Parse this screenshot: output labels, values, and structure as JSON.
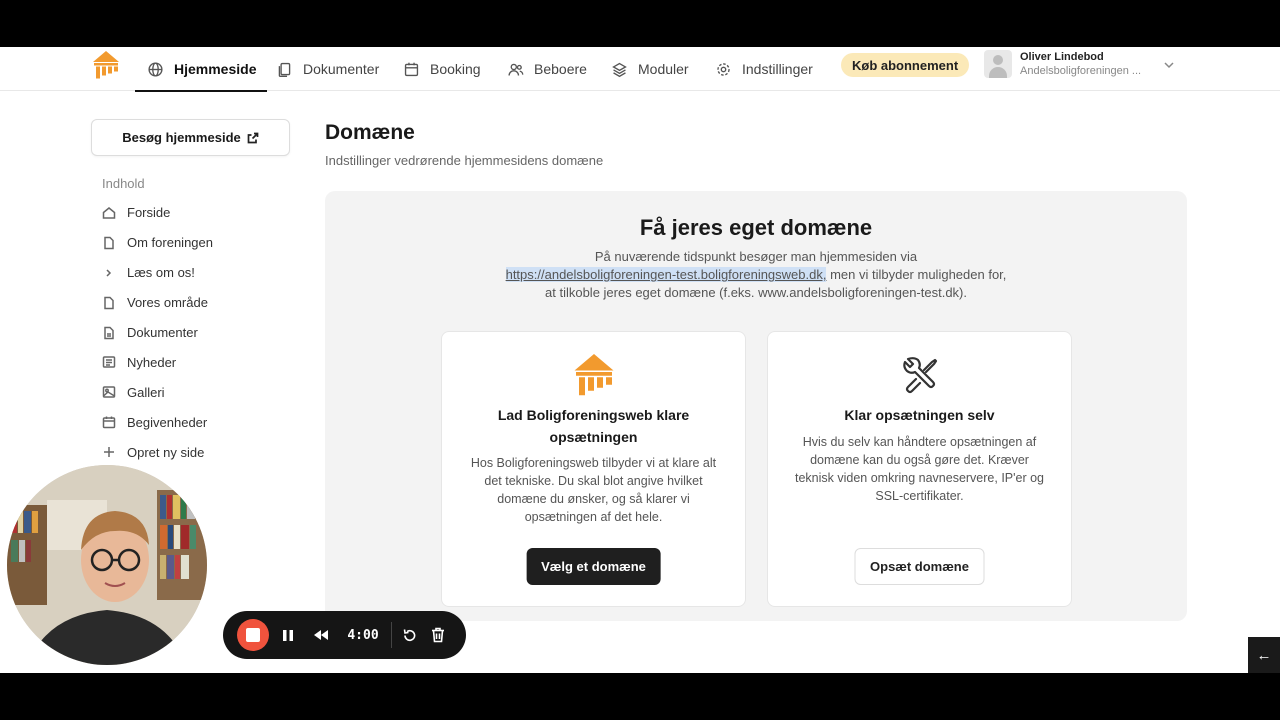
{
  "nav": {
    "items": [
      {
        "label": "Hjemmeside",
        "icon": "globe-icon",
        "active": true
      },
      {
        "label": "Dokumenter",
        "icon": "documents-icon"
      },
      {
        "label": "Booking",
        "icon": "calendar-icon"
      },
      {
        "label": "Beboere",
        "icon": "users-icon"
      },
      {
        "label": "Moduler",
        "icon": "layers-icon"
      },
      {
        "label": "Indstillinger",
        "icon": "gear-icon"
      }
    ],
    "buy_label": "Køb abonnement",
    "user_name": "Oliver Lindebod",
    "user_org": "Andelsboligforeningen ...",
    "accent_color": "#f29a2e",
    "buy_bg_color": "#fbe9b8"
  },
  "sidebar": {
    "visit_label": "Besøg hjemmeside",
    "heading": "Indhold",
    "items": [
      {
        "label": "Forside",
        "icon": "home-icon"
      },
      {
        "label": "Om foreningen",
        "icon": "page-icon"
      },
      {
        "label": "Læs om os!",
        "icon": "chevron-right-icon"
      },
      {
        "label": "Vores område",
        "icon": "page-icon"
      },
      {
        "label": "Dokumenter",
        "icon": "document-icon"
      },
      {
        "label": "Nyheder",
        "icon": "newspaper-icon"
      },
      {
        "label": "Galleri",
        "icon": "image-icon"
      },
      {
        "label": "Begivenheder",
        "icon": "calendar-icon"
      },
      {
        "label": "Opret ny side",
        "icon": "plus-icon"
      }
    ]
  },
  "main": {
    "title": "Domæne",
    "subtitle": "Indstillinger vedrørende hjemmesidens domæne",
    "panel": {
      "title": "Få jeres eget domæne",
      "text_pre": "På nuværende tidspunkt besøger man hjemmesiden via",
      "link": "https://andelsboligforeningen-test.boligforeningsweb.dk,",
      "text_mid": " men vi tilbyder muligheden for,",
      "text_post": "at tilkoble jeres eget domæne (f.eks. www.andelsboligforeningen-test.dk)."
    },
    "cards": [
      {
        "title": "Lad Boligforeningsweb klare opsætningen",
        "text": "Hos Boligforeningsweb tilbyder vi at klare alt det tekniske. Du skal blot angive hvilket domæne du ønsker, og så klarer vi opsætningen af det hele.",
        "button": "Vælg et domæne"
      },
      {
        "title": "Klar opsætningen selv",
        "text": "Hvis du selv kan håndtere opsætningen af domæne kan du også gøre det. Kræver teknisk viden omkring navneservere, IP'er og SSL-certifikater.",
        "button": "Opsæt domæne"
      }
    ]
  },
  "recorder": {
    "time": "4:00",
    "stop_color": "#f0533d"
  }
}
